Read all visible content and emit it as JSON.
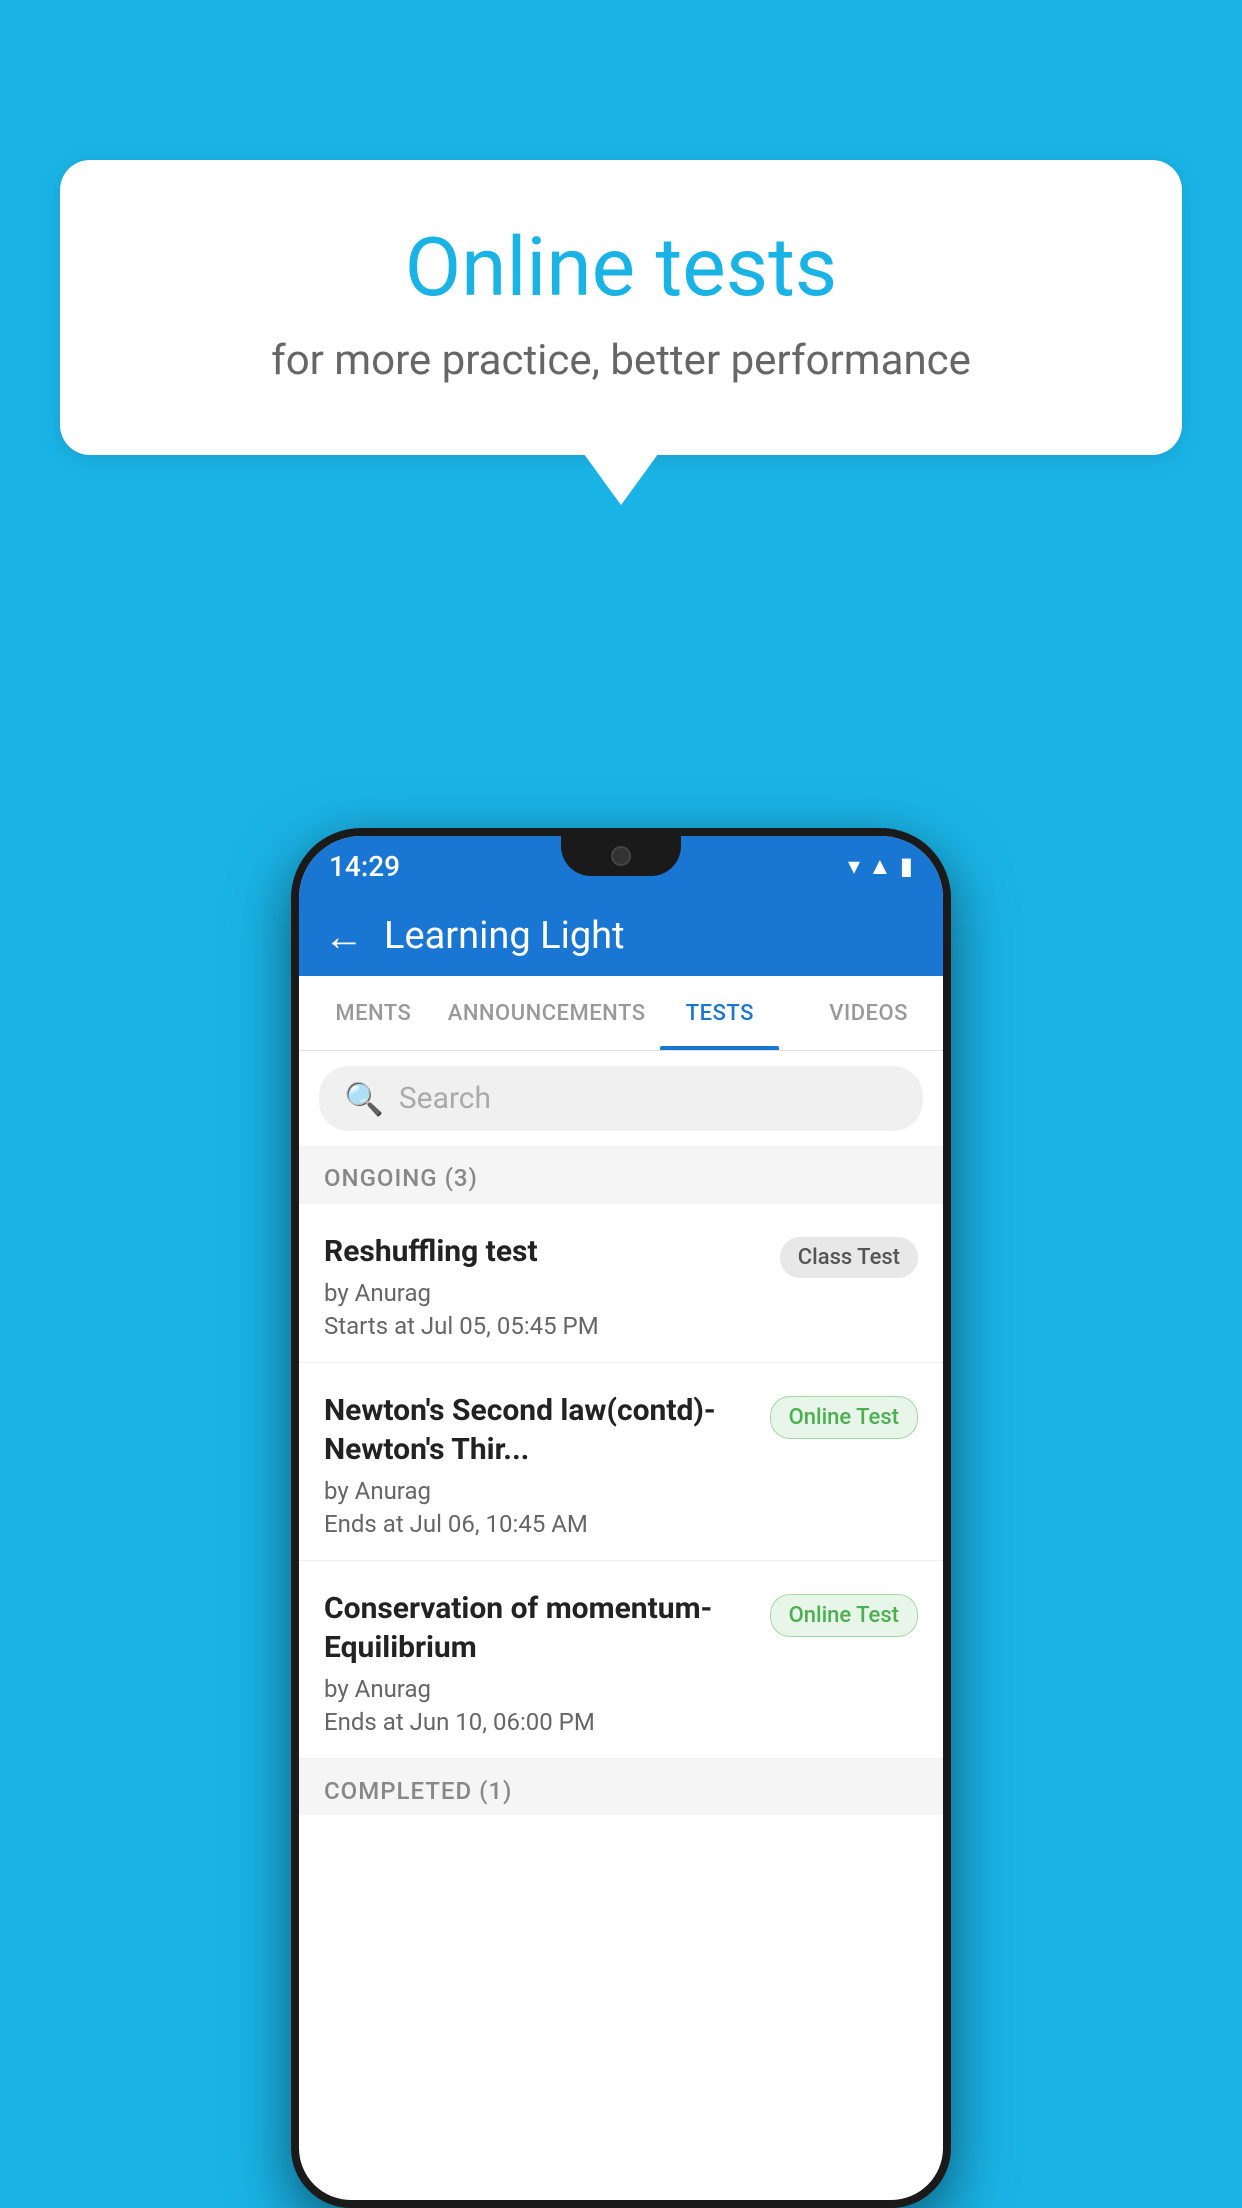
{
  "background_color": "#1ab3e6",
  "bubble": {
    "title": "Online tests",
    "subtitle": "for more practice, better performance"
  },
  "phone": {
    "status_time": "14:29",
    "app_title": "Learning Light",
    "back_button_label": "←",
    "tabs": [
      {
        "label": "MENTS",
        "active": false
      },
      {
        "label": "ANNOUNCEMENTS",
        "active": false
      },
      {
        "label": "TESTS",
        "active": true
      },
      {
        "label": "VIDEOS",
        "active": false
      }
    ],
    "search_placeholder": "Search",
    "section_ongoing": "ONGOING (3)",
    "tests": [
      {
        "name": "Reshuffling test",
        "by": "by Anurag",
        "date": "Starts at  Jul 05, 05:45 PM",
        "badge": "Class Test",
        "badge_type": "class"
      },
      {
        "name": "Newton's Second law(contd)-Newton's Thir...",
        "by": "by Anurag",
        "date": "Ends at  Jul 06, 10:45 AM",
        "badge": "Online Test",
        "badge_type": "online"
      },
      {
        "name": "Conservation of momentum-Equilibrium",
        "by": "by Anurag",
        "date": "Ends at  Jun 10, 06:00 PM",
        "badge": "Online Test",
        "badge_type": "online"
      }
    ],
    "section_completed": "COMPLETED (1)"
  }
}
